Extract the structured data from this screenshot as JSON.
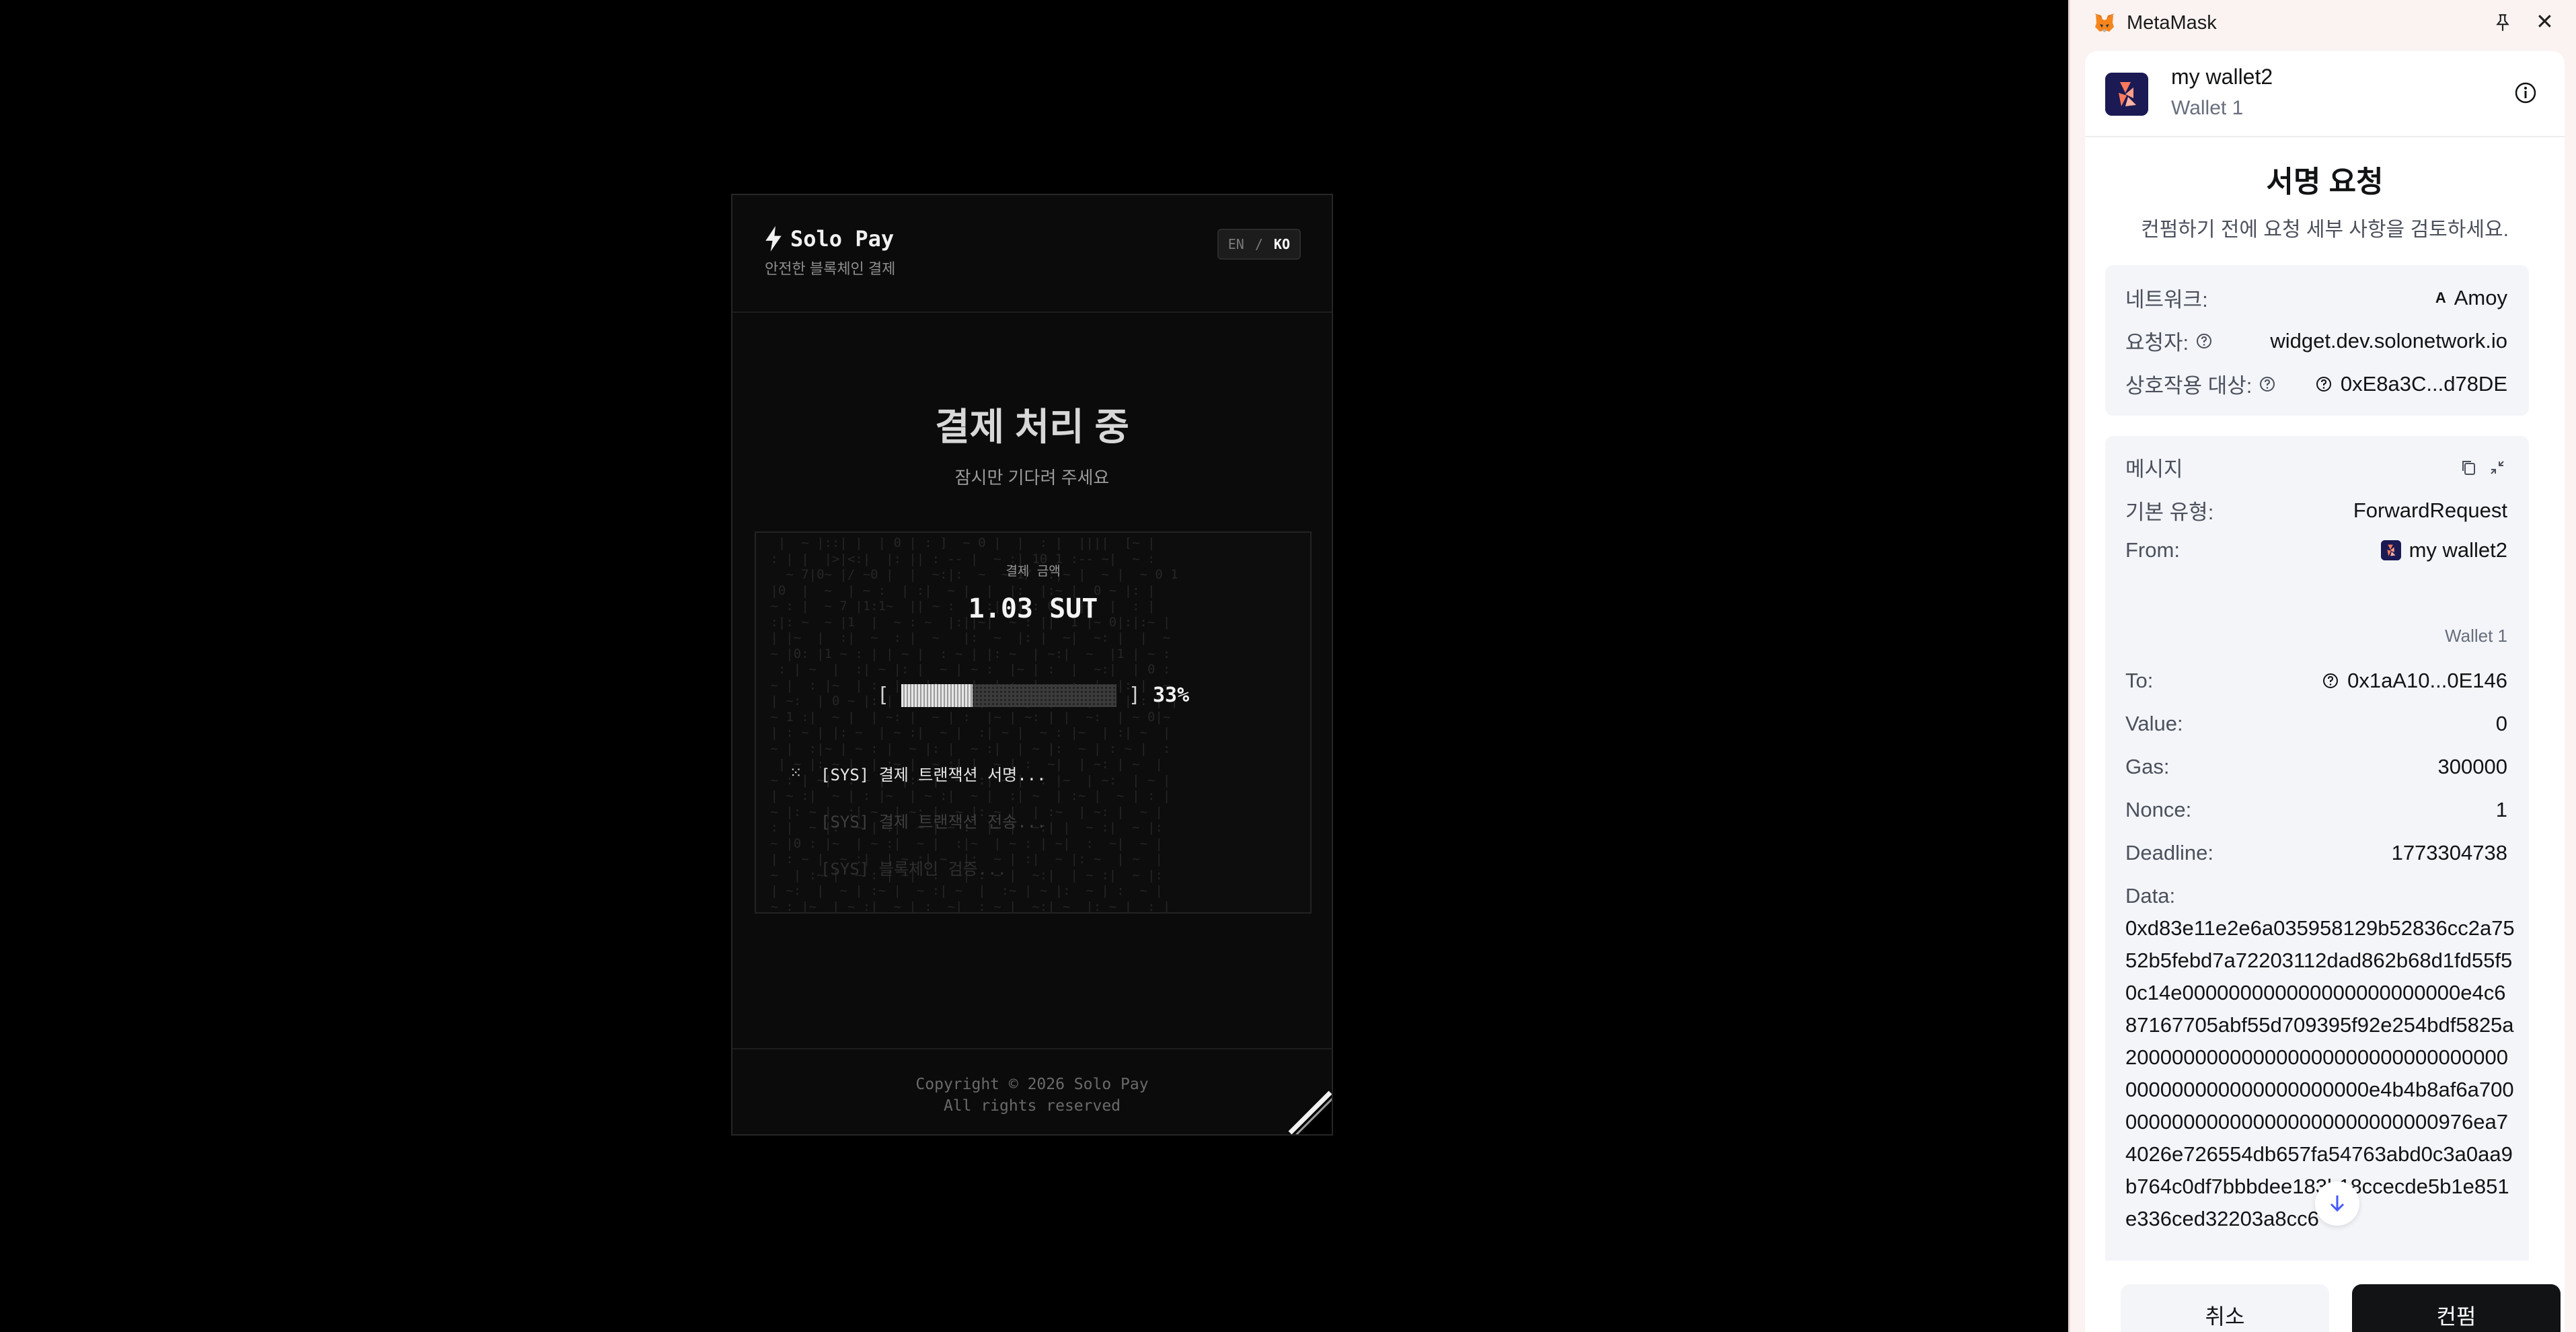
{
  "widget": {
    "brand": "Solo Pay",
    "tagline": "안전한 블록체인 결제",
    "lang": {
      "en": "EN",
      "sep": "/",
      "ko": "KO",
      "active": "KO"
    },
    "title": "결제 처리 중",
    "subtitle": "잠시만 기다려 주세요",
    "amount_label": "결제 금액",
    "amount": "1.03 SUT",
    "progress": {
      "open": "[",
      "close": "]",
      "percent_text": "33%",
      "value": 0.33
    },
    "logs": [
      {
        "icon": "⁙",
        "text": "[SYS] 결제 트랜잭션 서명..."
      },
      {
        "icon": "",
        "text": "[SYS] 결제 트랜잭션 전송..."
      },
      {
        "icon": "",
        "text": "[SYS] 블록체인 검증..."
      }
    ],
    "footer_line1": "Copyright © 2026 Solo Pay",
    "footer_line2": "All rights reserved"
  },
  "metamask": {
    "app_name": "MetaMask",
    "account_name": "my wallet2",
    "account_sub": "Wallet 1",
    "title": "서명 요청",
    "subtitle": "컨펌하기 전에 요청 세부 사항을 검토하세요.",
    "network_label": "네트워크:",
    "network_badge": "A",
    "network_value": "Amoy",
    "requester_label": "요청자:",
    "requester_value": "widget.dev.solonetwork.io",
    "interact_label": "상호작용 대상:",
    "interact_value": "0xE8a3C...d78DE",
    "message_label": "메시지",
    "primary_type_label": "기본 유형:",
    "primary_type_value": "ForwardRequest",
    "from_label": "From:",
    "from_value": "my wallet2",
    "from_sub": "Wallet 1",
    "to_label": "To:",
    "to_value": "0x1aA10...0E146",
    "value_label": "Value:",
    "value_value": "0",
    "gas_label": "Gas:",
    "gas_value": "300000",
    "nonce_label": "Nonce:",
    "nonce_value": "1",
    "deadline_label": "Deadline:",
    "deadline_value": "1773304738",
    "data_label": "Data:",
    "data_value": "0xd83e11e2e6a035958129b52836cc2a7552b5febd7a72203112dad862b68d1fd55f50c14e000000000000000000000000e4c687167705abf55d709395f92e254bdf5825a200000000000000000000000000000000000000000000000000000e4b4b8af6a700000000000000000000000000000976ea74026e726554db657fa54763abd0c3a0aa9b764c0df7bbbdee183b18ccecde5b1e851e336ced32203a8cc6",
    "cancel": "취소",
    "confirm": "컨펌"
  }
}
